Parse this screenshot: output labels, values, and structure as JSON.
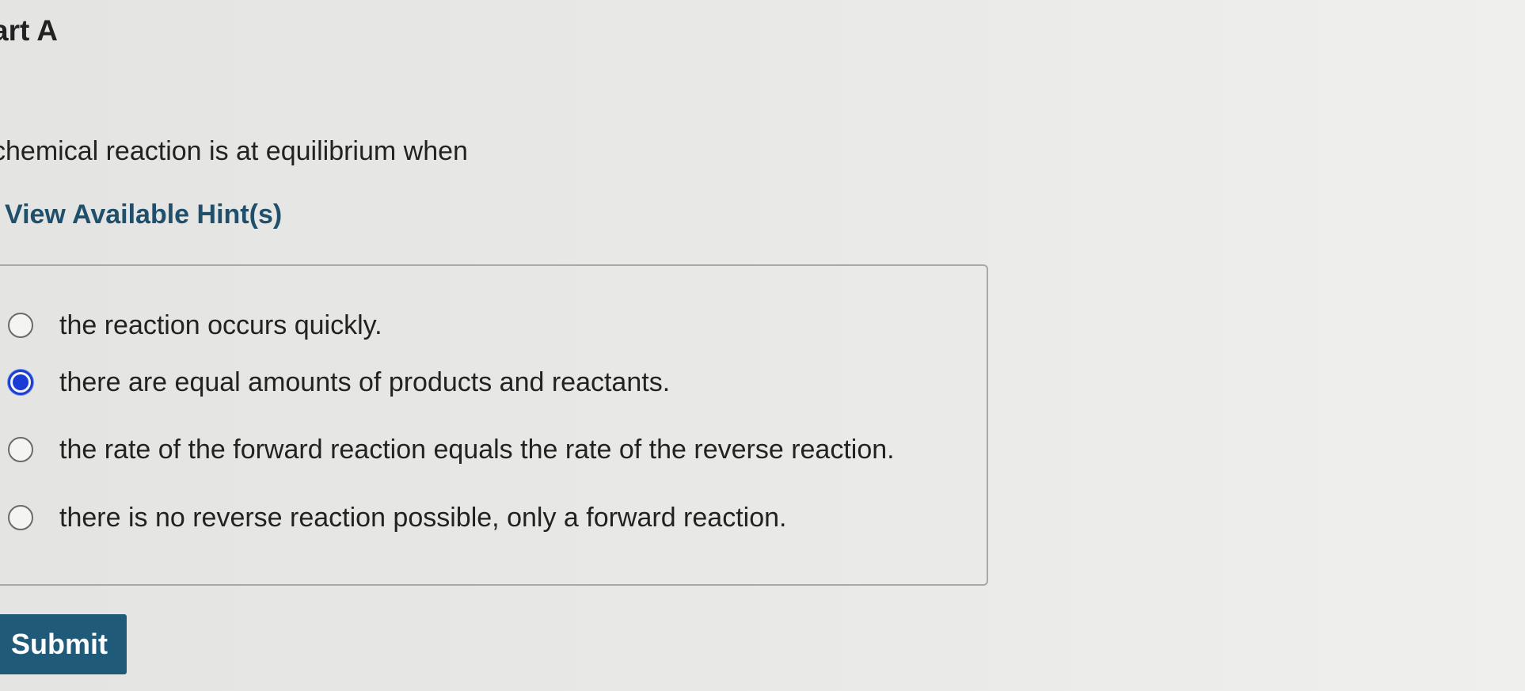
{
  "part": {
    "title": "art A"
  },
  "question": {
    "text": "chemical reaction is at equilibrium when",
    "hint_link": "View Available Hint(s)"
  },
  "options": [
    {
      "label": "the reaction occurs quickly.",
      "selected": false
    },
    {
      "label": "there are equal amounts of products and reactants.",
      "selected": true
    },
    {
      "label": "the rate of the forward reaction equals the rate of the reverse reaction.",
      "selected": false
    },
    {
      "label": "there is no reverse reaction possible, only a forward reaction.",
      "selected": false
    }
  ],
  "actions": {
    "submit_label": "Submit"
  },
  "colors": {
    "accent": "#1f5a79",
    "link": "#1f4f6b",
    "radio_selected": "#1b3bd6"
  }
}
